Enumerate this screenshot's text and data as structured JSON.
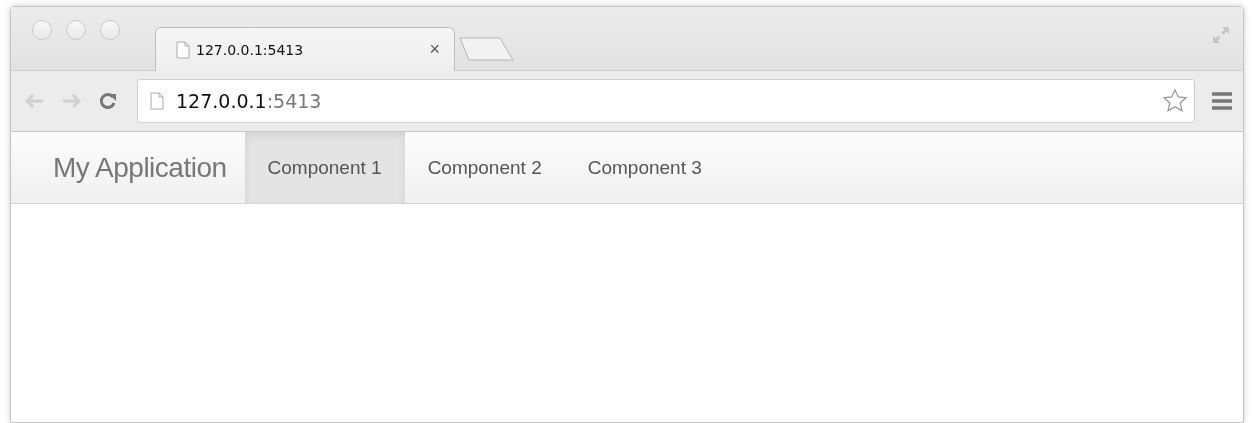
{
  "browser_tab": {
    "title": "127.0.0.1:5413",
    "close": "×"
  },
  "address_bar": {
    "host": "127.0.0.1",
    "port": ":5413"
  },
  "navbar": {
    "brand": "My Application",
    "items": [
      {
        "label": "Component 1",
        "selected": true
      },
      {
        "label": "Component 2",
        "selected": false
      },
      {
        "label": "Component 3",
        "selected": false
      }
    ]
  }
}
